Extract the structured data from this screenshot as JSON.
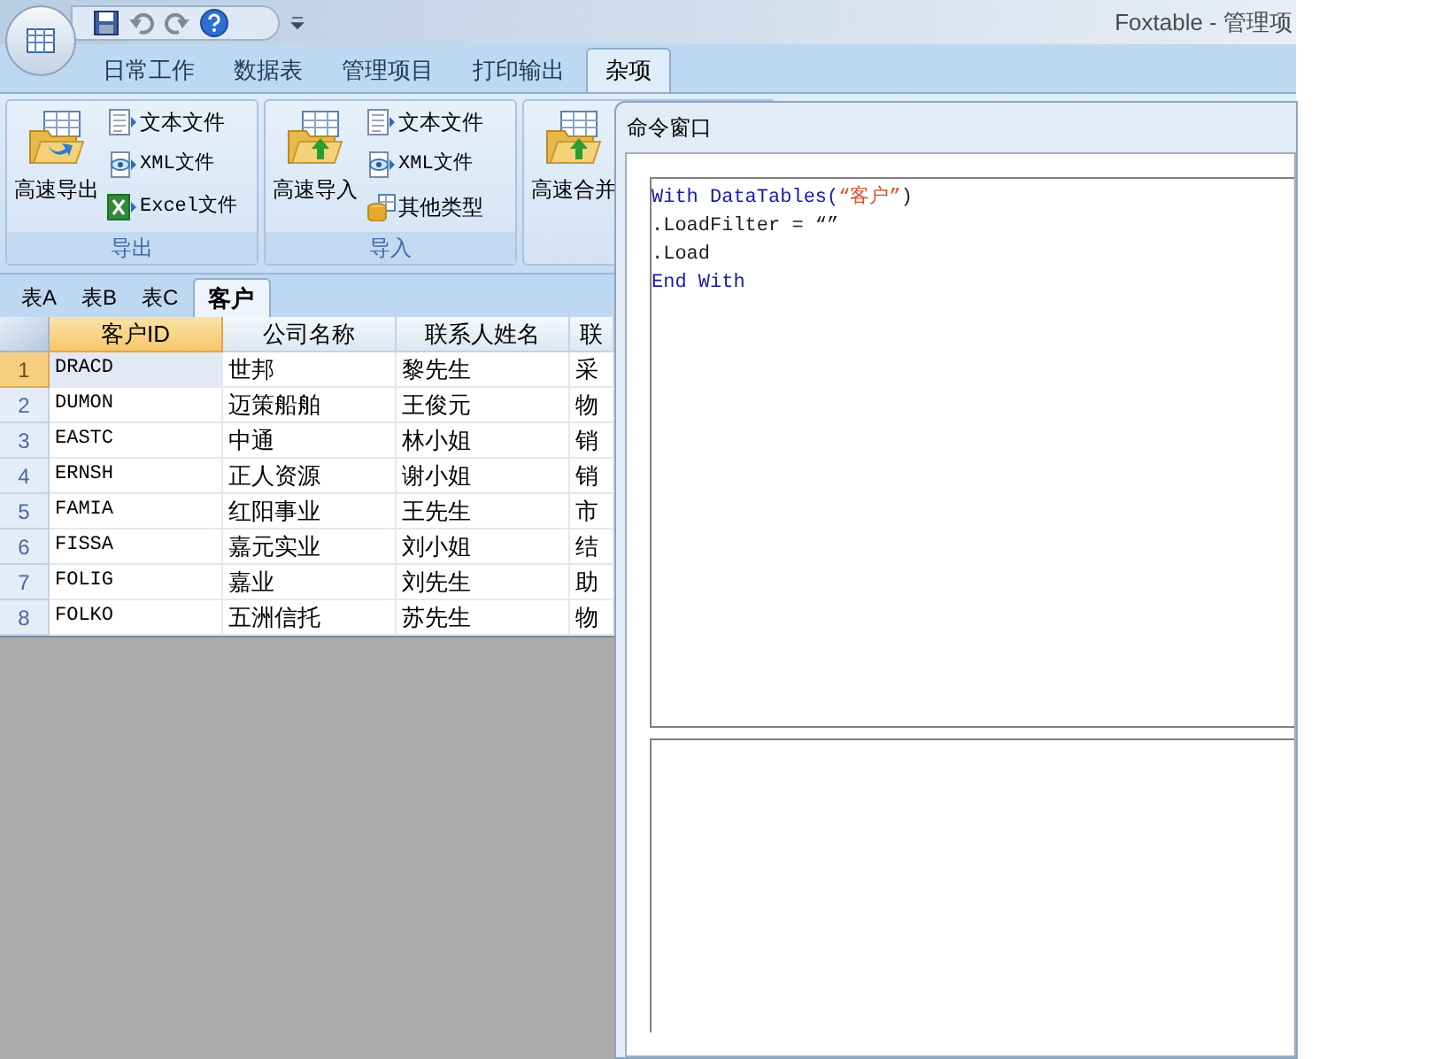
{
  "window": {
    "title": "Foxtable - 管理项"
  },
  "ribbon_tabs": [
    {
      "label": "日常工作",
      "selected": false
    },
    {
      "label": "数据表",
      "selected": false
    },
    {
      "label": "管理项目",
      "selected": false
    },
    {
      "label": "打印输出",
      "selected": false
    },
    {
      "label": "杂项",
      "selected": true
    }
  ],
  "ribbon_groups": [
    {
      "label": "导出",
      "large": {
        "label": "高速导出",
        "kind": "export"
      },
      "small": [
        {
          "label": "文本文件",
          "kind": "text"
        },
        {
          "label": "XML文件",
          "kind": "xml"
        },
        {
          "label": "Excel文件",
          "kind": "excel"
        }
      ]
    },
    {
      "label": "导入",
      "large": {
        "label": "高速导入",
        "kind": "import"
      },
      "small": [
        {
          "label": "文本文件",
          "kind": "text"
        },
        {
          "label": "XML文件",
          "kind": "xml"
        },
        {
          "label": "其他类型",
          "kind": "db"
        }
      ]
    },
    {
      "large": {
        "label": "高速合并",
        "kind": "import"
      }
    }
  ],
  "sheet_tabs": [
    {
      "label": "表A",
      "selected": false
    },
    {
      "label": "表B",
      "selected": false
    },
    {
      "label": "表C",
      "selected": false
    },
    {
      "label": "客户",
      "selected": true
    }
  ],
  "table": {
    "columns": [
      {
        "label": "客户ID",
        "selected": true
      },
      {
        "label": "公司名称",
        "selected": false
      },
      {
        "label": "联系人姓名",
        "selected": false
      },
      {
        "label": "联",
        "selected": false
      }
    ],
    "rows": [
      {
        "number": "1",
        "selected": true,
        "cells": [
          "DRACD",
          "世邦",
          "黎先生",
          "采"
        ]
      },
      {
        "number": "2",
        "selected": false,
        "cells": [
          "DUMON",
          "迈策船舶",
          "王俊元",
          "物"
        ]
      },
      {
        "number": "3",
        "selected": false,
        "cells": [
          "EASTC",
          "中通",
          "林小姐",
          "销"
        ]
      },
      {
        "number": "4",
        "selected": false,
        "cells": [
          "ERNSH",
          "正人资源",
          "谢小姐",
          "销"
        ]
      },
      {
        "number": "5",
        "selected": false,
        "cells": [
          "FAMIA",
          "红阳事业",
          "王先生",
          "市"
        ]
      },
      {
        "number": "6",
        "selected": false,
        "cells": [
          "FISSA",
          "嘉元实业",
          "刘小姐",
          "结"
        ]
      },
      {
        "number": "7",
        "selected": false,
        "cells": [
          "FOLIG",
          "嘉业",
          "刘先生",
          "助"
        ]
      },
      {
        "number": "8",
        "selected": false,
        "cells": [
          "FOLKO",
          "五洲信托",
          "苏先生",
          "物"
        ]
      }
    ]
  },
  "command_window": {
    "title": "命令窗口",
    "code_lines": [
      [
        {
          "text": "With DataTables(",
          "kind": "keyword"
        },
        {
          "text": "“客户”",
          "kind": "string"
        },
        {
          "text": ")",
          "kind": "plain"
        }
      ],
      [
        {
          "text": ".LoadFilter = “”",
          "kind": "plain"
        }
      ],
      [
        {
          "text": ".Load",
          "kind": "plain"
        }
      ],
      [
        {
          "text": "End With",
          "kind": "keyword"
        }
      ]
    ]
  }
}
